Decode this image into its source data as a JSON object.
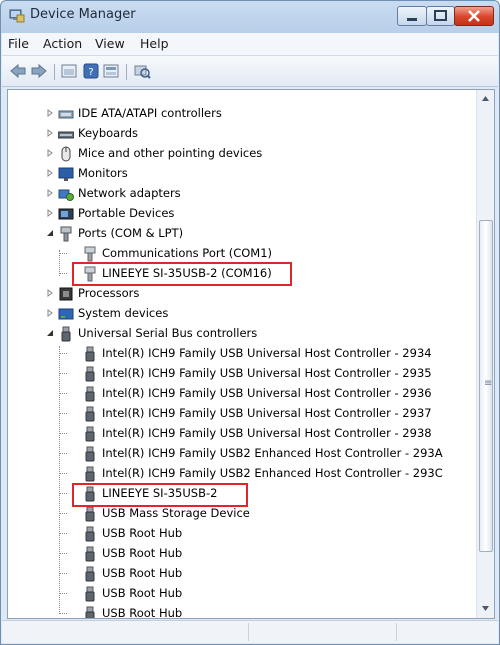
{
  "window": {
    "title": "Device Manager"
  },
  "menu": [
    "File",
    "Action",
    "View",
    "Help"
  ],
  "icons": {
    "app": "device-manager-icon",
    "toolbar": [
      "back-arrow-icon",
      "forward-arrow-icon",
      "properties-icon",
      "help-icon",
      "update-driver-icon",
      "scan-hardware-icon"
    ]
  },
  "tree": {
    "categories_top": [
      {
        "label": "IDE ATA/ATAPI controllers",
        "icon": "ide-controller-icon"
      },
      {
        "label": "Keyboards",
        "icon": "keyboard-icon"
      },
      {
        "label": "Mice and other pointing devices",
        "icon": "mouse-icon"
      },
      {
        "label": "Monitors",
        "icon": "monitor-icon"
      },
      {
        "label": "Network adapters",
        "icon": "network-adapter-icon"
      },
      {
        "label": "Portable Devices",
        "icon": "portable-device-icon"
      },
      {
        "label": "Ports (COM & LPT)",
        "icon": "port-icon"
      }
    ],
    "ports_children": [
      {
        "label": "Communications Port (COM1)",
        "icon": "com-port-icon"
      },
      {
        "label": "LINEEYE SI-35USB-2 (COM16)",
        "icon": "com-port-icon"
      }
    ],
    "categories_mid": [
      {
        "label": "Processors",
        "icon": "processor-icon"
      },
      {
        "label": "System devices",
        "icon": "system-devices-icon"
      },
      {
        "label": "Universal Serial Bus controllers",
        "icon": "usb-icon"
      }
    ],
    "usb_children": [
      {
        "label": "Intel(R) ICH9 Family USB Universal Host Controller - 2934"
      },
      {
        "label": "Intel(R) ICH9 Family USB Universal Host Controller - 2935"
      },
      {
        "label": "Intel(R) ICH9 Family USB Universal Host Controller - 2936"
      },
      {
        "label": "Intel(R) ICH9 Family USB Universal Host Controller - 2937"
      },
      {
        "label": "Intel(R) ICH9 Family USB Universal Host Controller - 2938"
      },
      {
        "label": "Intel(R) ICH9 Family USB2 Enhanced Host Controller - 293A"
      },
      {
        "label": "Intel(R) ICH9 Family USB2 Enhanced Host Controller - 293C"
      },
      {
        "label": "LINEEYE SI-35USB-2"
      },
      {
        "label": "USB Mass Storage Device"
      },
      {
        "label": "USB Root Hub"
      },
      {
        "label": "USB Root Hub"
      },
      {
        "label": "USB Root Hub"
      },
      {
        "label": "USB Root Hub"
      },
      {
        "label": "USB Root Hub"
      }
    ]
  },
  "colors": {
    "highlight": "#e0262b"
  }
}
